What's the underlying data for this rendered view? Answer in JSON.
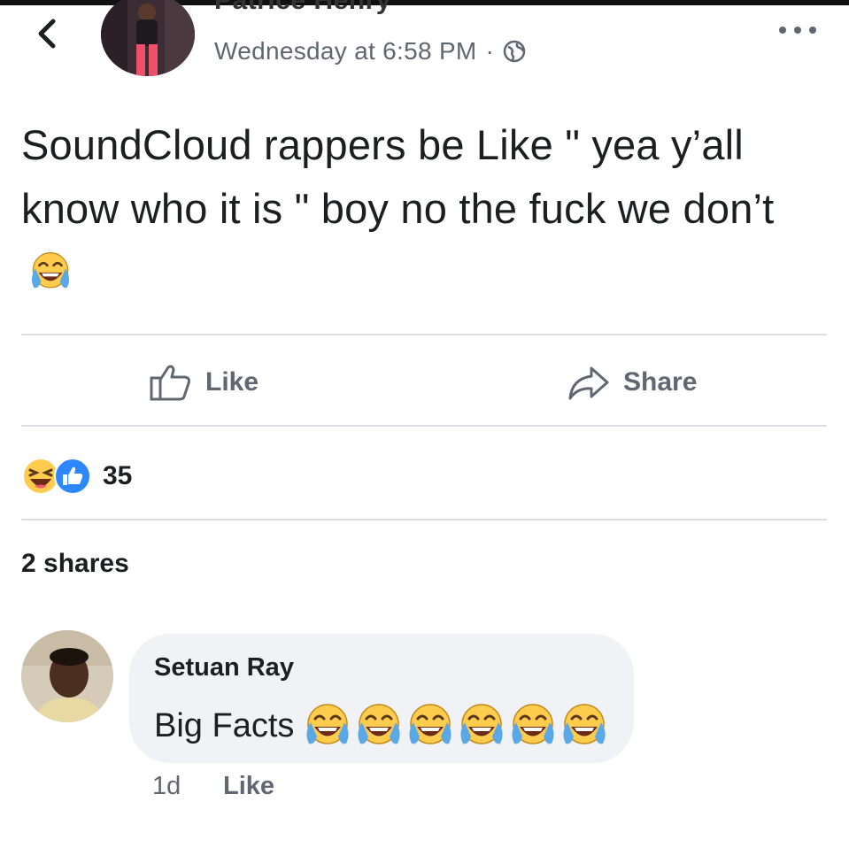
{
  "post": {
    "author": "Patrice Henry",
    "timestamp": "Wednesday at 6:58 PM",
    "separator": "·",
    "privacy_icon": "globe-icon",
    "text": "SoundCloud rappers be Like \" yea y’all know who it is \" boy no the fuck we don’t",
    "text_emoji": "tears-of-joy-emoji"
  },
  "actions": {
    "like_label": "Like",
    "share_label": "Share"
  },
  "reactions": {
    "icons": [
      "laughing-reaction-icon",
      "like-reaction-icon"
    ],
    "count": "35"
  },
  "shares_text": "2 shares",
  "comment": {
    "author": "Setuan Ray",
    "text": "Big Facts",
    "emoji_count": 6,
    "time": "1d",
    "like_label": "Like"
  },
  "colors": {
    "text": "#1c1e21",
    "secondary_text": "#606770",
    "like_blue": "#2d88ff",
    "emoji_yellow": "#ffcc4d",
    "bubble_bg": "#f1f2f6",
    "divider": "#dadde1"
  }
}
